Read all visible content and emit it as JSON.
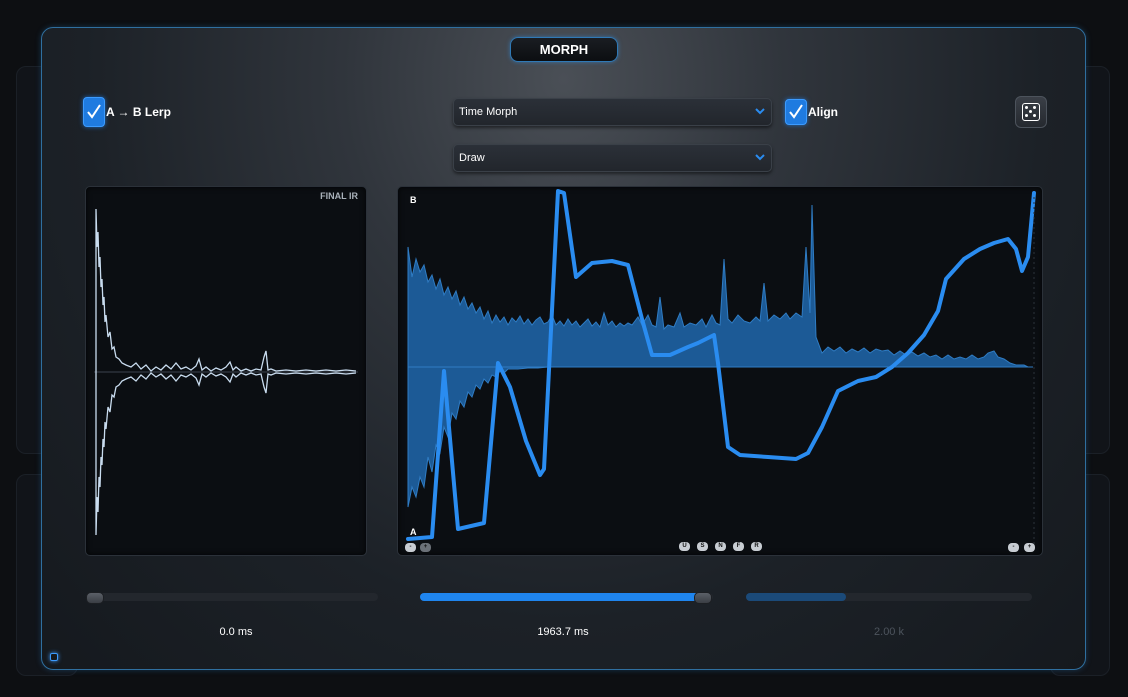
{
  "title": "MORPH",
  "lerp": {
    "label": "A → B Lerp",
    "checked": true
  },
  "morph_mode": {
    "selected": "Time Morph"
  },
  "draw_mode": {
    "selected": "Draw"
  },
  "align": {
    "label": "Align",
    "checked": true
  },
  "randomize_icon": "dice-icon",
  "final_ir": {
    "label": "FINAL IR"
  },
  "morph_editor": {
    "label_top": "B",
    "label_bottom": "A",
    "left_buttons": [
      "-",
      "+"
    ],
    "center_buttons": [
      "U",
      "S",
      "N",
      "F",
      "R"
    ],
    "right_buttons": [
      "-",
      "+"
    ]
  },
  "sliders": [
    {
      "name": "time-offset",
      "fraction": 0.0,
      "readout": "0.0 ms",
      "enabled": true
    },
    {
      "name": "time-length",
      "fraction": 0.96,
      "readout": "1963.7 ms",
      "enabled": true
    },
    {
      "name": "frequency",
      "fraction": 0.35,
      "readout": "2.00 k",
      "enabled": false
    }
  ],
  "colors": {
    "accent": "#1f85ee",
    "border": "#2f6f9f",
    "waveform": "#c9dcef"
  }
}
